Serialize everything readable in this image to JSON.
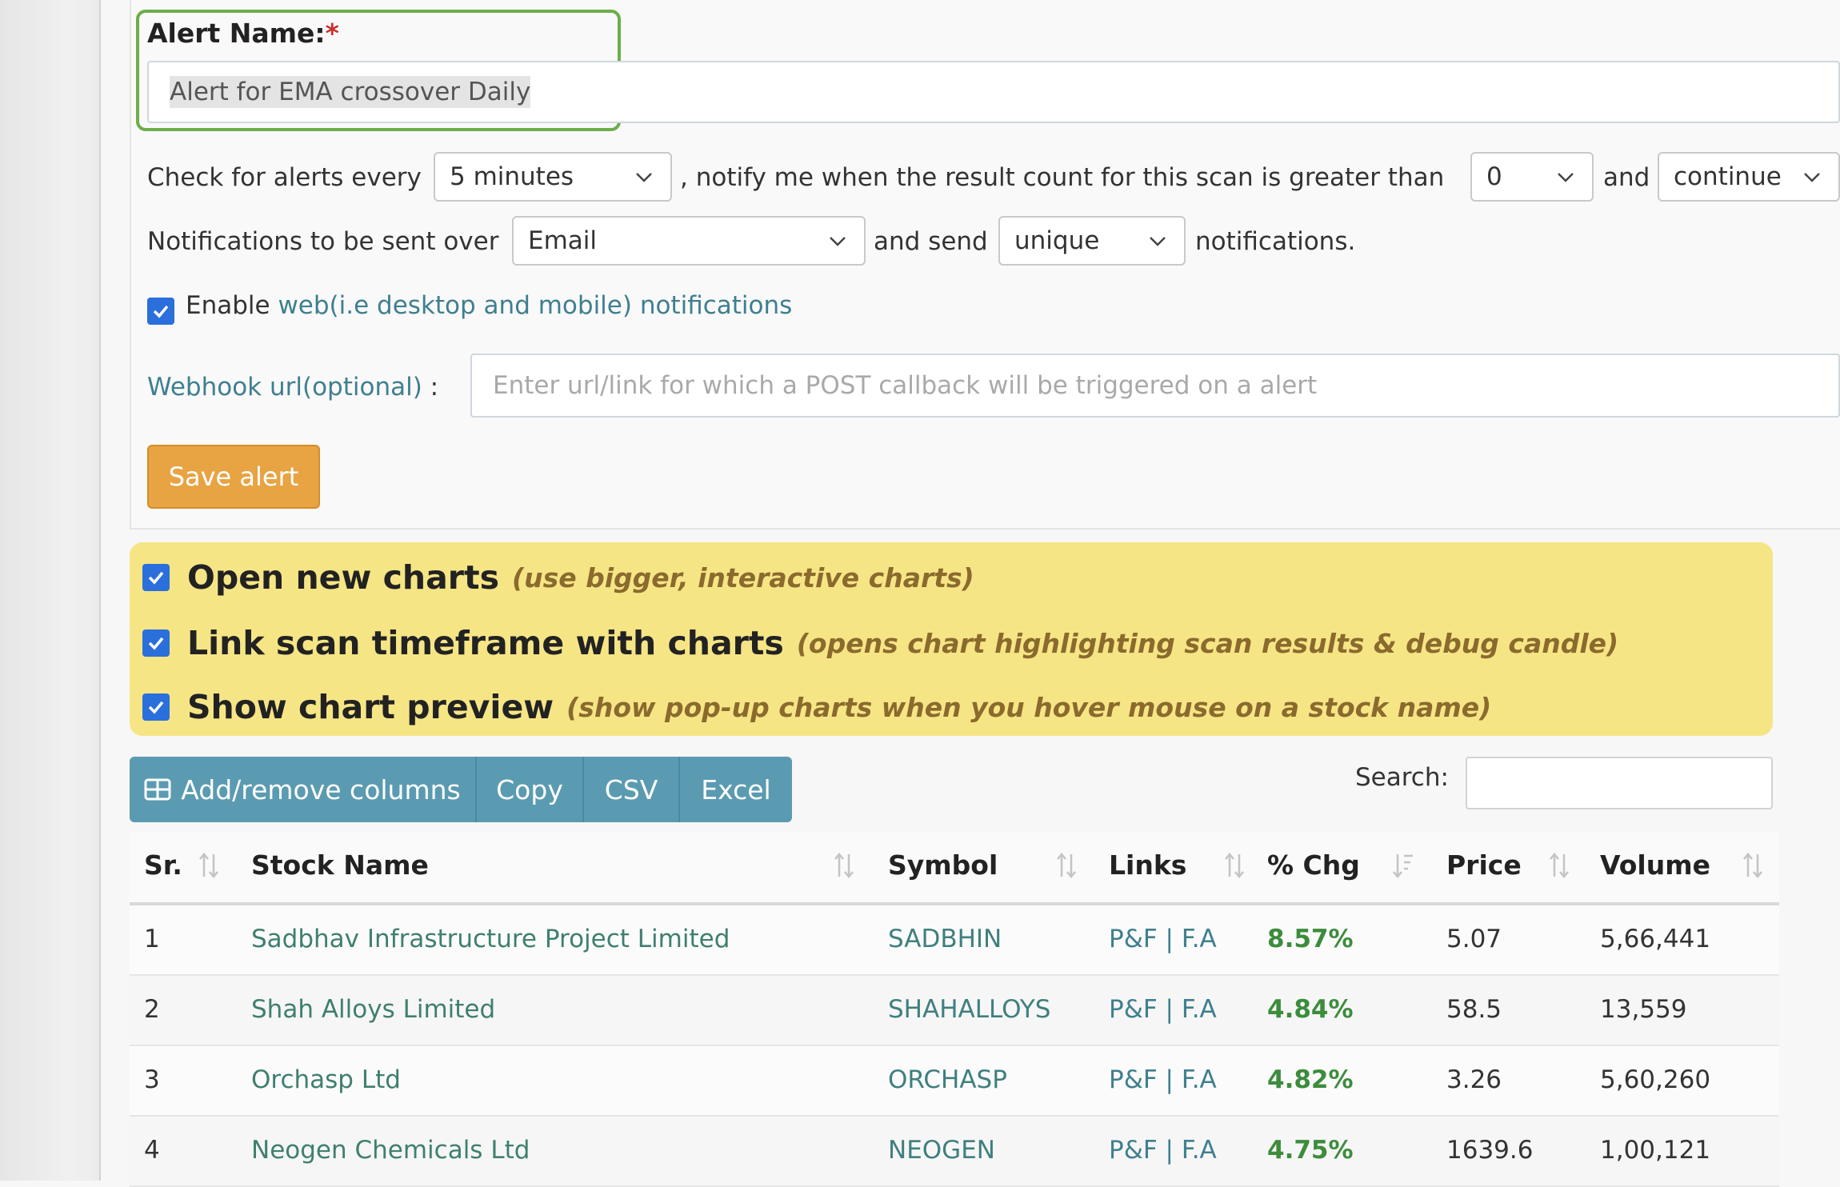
{
  "alert": {
    "name_label": "Alert Name:",
    "required_mark": "*",
    "name_value": "Alert for EMA crossover Daily",
    "check_text": "Check for alerts every",
    "interval": "5 minutes",
    "notify_text": ", notify me when the result count for this scan is greater than",
    "threshold": "0",
    "and_text": "and",
    "mode": "continue",
    "notif_over_text": "Notifications to be sent over",
    "channel": "Email",
    "and_send_text": "and send",
    "uniqueness": "unique",
    "notifications_text": "notifications.",
    "enable_text": "Enable",
    "web_notif_link": "web(i.e desktop and mobile) notifications",
    "webhook_label": "Webhook url(optional)",
    "webhook_colon": ":",
    "webhook_placeholder": "Enter url/link for which a POST callback will be triggered on a alert",
    "save_label": "Save alert"
  },
  "options": [
    {
      "title": "Open new charts",
      "hint": "(use bigger, interactive charts)"
    },
    {
      "title": "Link scan timeframe with charts",
      "hint": "(opens chart highlighting scan results & debug candle)"
    },
    {
      "title": "Show chart preview",
      "hint": "(show pop-up charts when you hover mouse on a stock name)"
    }
  ],
  "toolbar": {
    "columns_label": "Add/remove columns",
    "copy_label": "Copy",
    "csv_label": "CSV",
    "excel_label": "Excel"
  },
  "search_label": "Search:",
  "table": {
    "headers": [
      "Sr.",
      "Stock Name",
      "Symbol",
      "Links",
      "% Chg",
      "Price",
      "Volume"
    ],
    "rows": [
      {
        "sr": "1",
        "name": "Sadbhav Infrastructure Project Limited",
        "symbol": "SADBHIN",
        "links": "P&F | F.A",
        "chg": "8.57%",
        "price": "5.07",
        "volume": "5,66,441"
      },
      {
        "sr": "2",
        "name": "Shah Alloys Limited",
        "symbol": "SHAHALLOYS",
        "links": "P&F | F.A",
        "chg": "4.84%",
        "price": "58.5",
        "volume": "13,559"
      },
      {
        "sr": "3",
        "name": "Orchasp Ltd",
        "symbol": "ORCHASP",
        "links": "P&F | F.A",
        "chg": "4.82%",
        "price": "3.26",
        "volume": "5,60,260"
      },
      {
        "sr": "4",
        "name": "Neogen Chemicals Ltd",
        "symbol": "NEOGEN",
        "links": "P&F | F.A",
        "chg": "4.75%",
        "price": "1639.6",
        "volume": "1,00,121"
      }
    ]
  },
  "colors": {
    "accent_orange": "#e8a343",
    "toolbar_blue": "#5b9bb1",
    "options_yellow": "#f6e585",
    "positive_green": "#3c8c3c",
    "checkbox_blue": "#2a6fdb"
  }
}
